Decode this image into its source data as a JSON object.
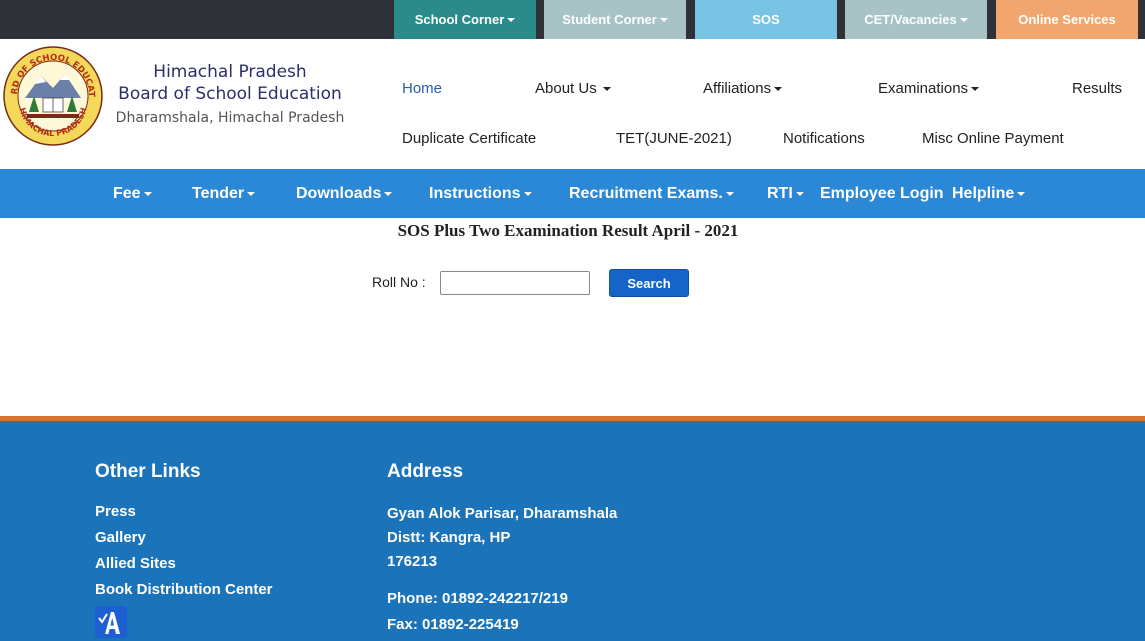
{
  "top_nav": {
    "school_corner": "School Corner",
    "student_corner": "Student Corner",
    "sos": "SOS",
    "cet_vacancies": "CET/Vacancies",
    "online_services": "Online Services"
  },
  "brand": {
    "line1": "Himachal Pradesh",
    "line2": "Board of School Education",
    "line3": "Dharamshala, Himachal Pradesh",
    "logo_ring_text": "BOARD OF SCHOOL EDUCATION",
    "logo_bottom_text": "HIMACHAL PRADESH"
  },
  "main_nav": {
    "home": "Home",
    "about_us": "About Us",
    "affiliations": "Affiliations",
    "examinations": "Examinations",
    "results": "Results",
    "duplicate_certificate": "Duplicate Certificate",
    "tet": "TET(JUNE-2021)",
    "notifications": "Notifications",
    "misc_online_payment": "Misc Online Payment"
  },
  "blue_nav": {
    "fee": "Fee",
    "tender": "Tender",
    "downloads": "Downloads",
    "instructions": "Instructions",
    "recruitment_exams": "Recruitment Exams.",
    "rti": "RTI",
    "employee_login": "Employee Login",
    "helpline": "Helpline"
  },
  "page": {
    "title": "SOS Plus Two Examination Result April - 2021",
    "roll_label": "Roll No :",
    "roll_value": "",
    "search_label": "Search"
  },
  "footer": {
    "other_links_heading": "Other Links",
    "links": [
      "Press",
      "Gallery",
      "Allied Sites",
      "Book Distribution Center"
    ],
    "address_heading": "Address",
    "address_line1": "Gyan Alok Parisar, Dharamshala",
    "address_line2": "Distt: Kangra, HP",
    "address_line3": "176213",
    "phone": "Phone: 01892-242217/219",
    "fax": "Fax: 01892-225419"
  },
  "colors": {
    "top_bar": "#2f3138",
    "school_corner": "#2a8b8a",
    "student_corner": "#a7c3c5",
    "sos": "#78c3e4",
    "cet_vacancies": "#a7c3c5",
    "online_services": "#f0a66e",
    "blue_nav": "#2a88d6",
    "footer": "#1b73b9",
    "footer_line": "#d9722b",
    "search_button": "#1565c9"
  }
}
